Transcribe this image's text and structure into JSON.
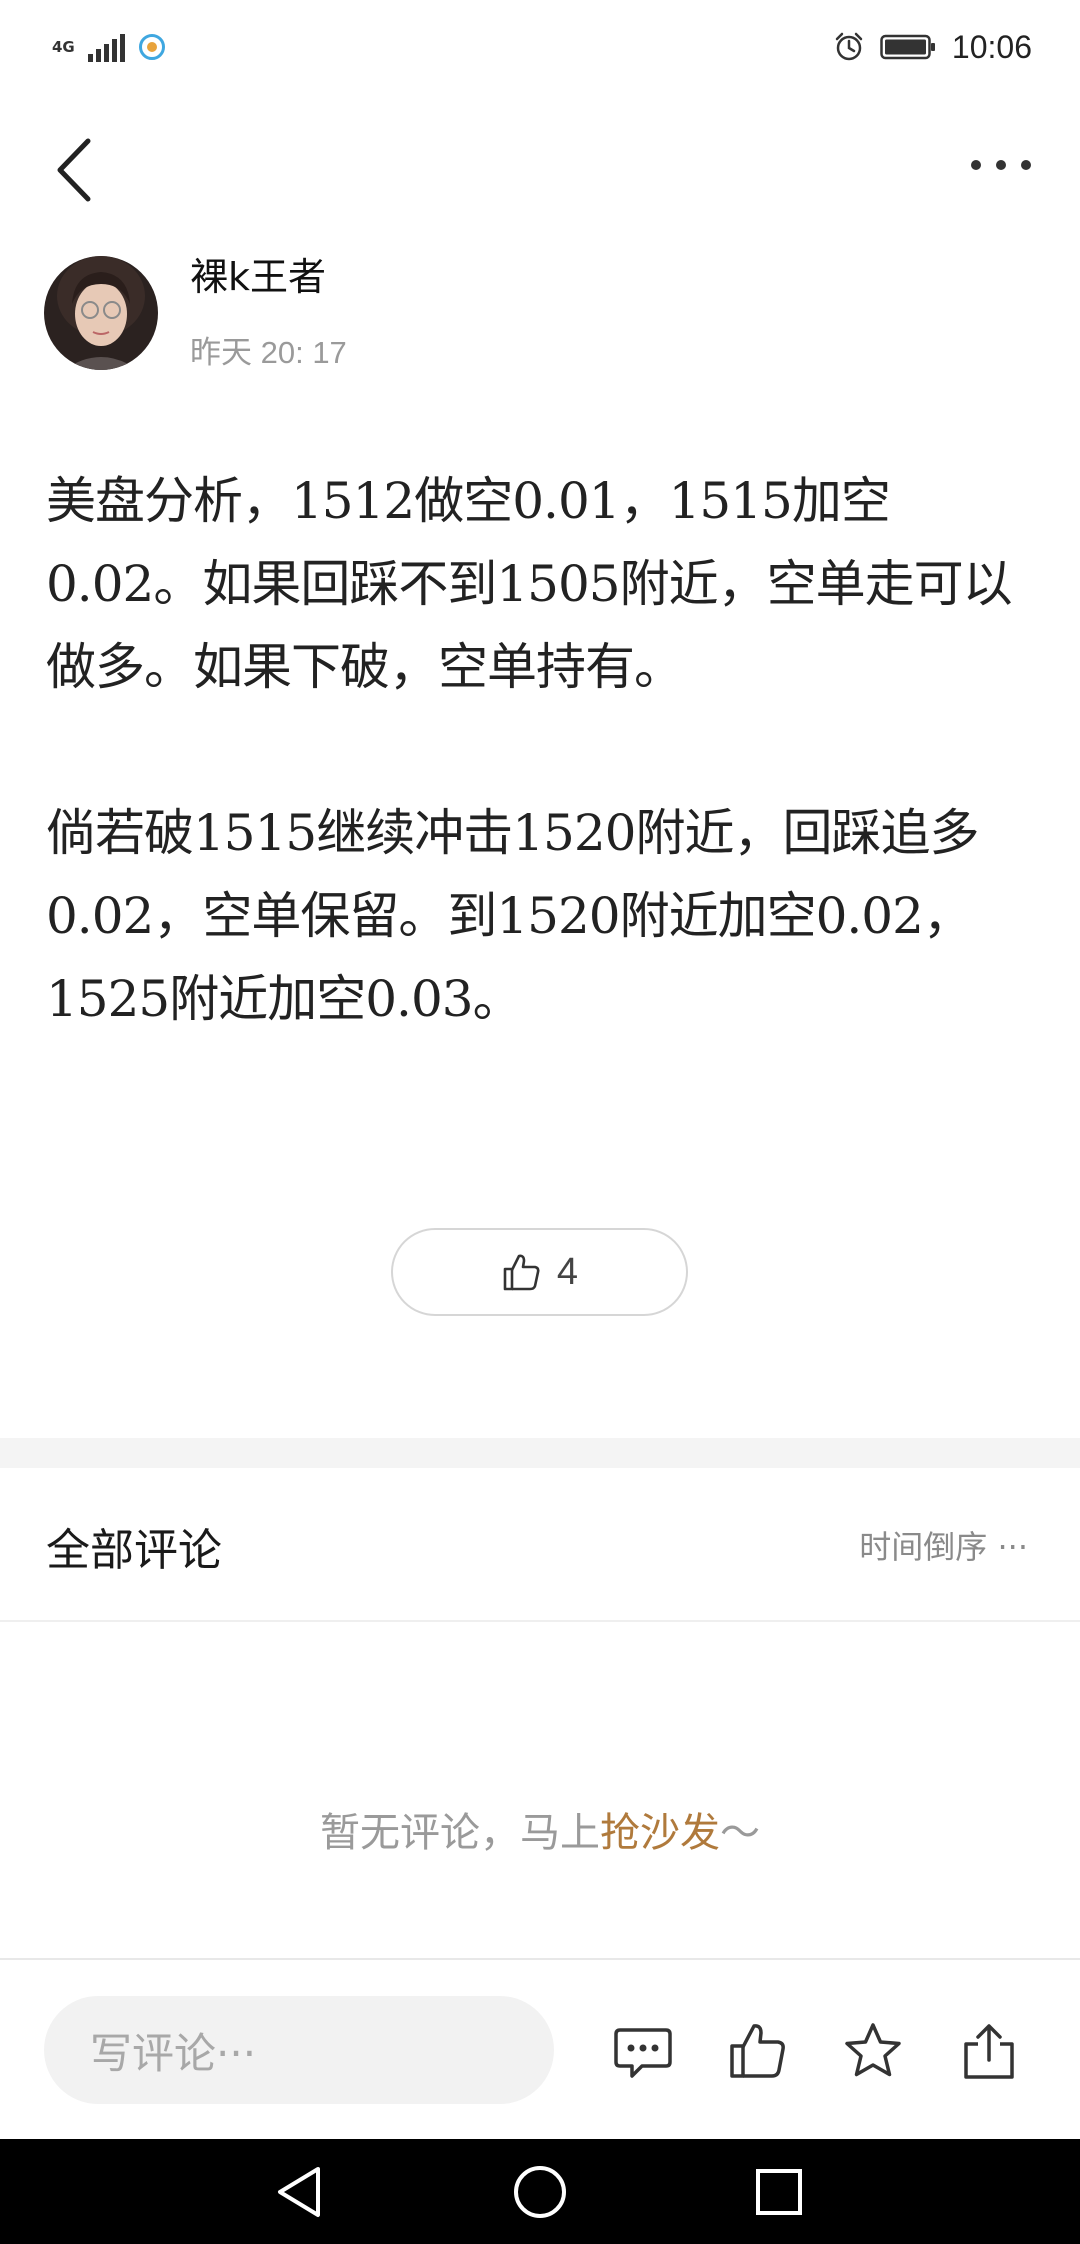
{
  "status_bar": {
    "network_type": "4G",
    "time": "10:06"
  },
  "colors": {
    "accent": "#b07a3c",
    "muted_text": "#9a9a9a",
    "divider": "#f4f4f4"
  },
  "author": {
    "name": "裸k王者",
    "time": "昨天 20: 17"
  },
  "post": {
    "paragraphs": [
      "美盘分析，1512做空0.01，1515加空0.02。如果回踩不到1505附近，空单走可以做多。如果下破，空单持有。",
      "倘若破1515继续冲击1520附近，回踩追多0.02，空单保留。到1520附近加空0.02，1525附近加空0.03。"
    ]
  },
  "like": {
    "icon": "thumbs-up-icon",
    "count": "4"
  },
  "comments": {
    "title": "全部评论",
    "sort": "时间倒序 ···",
    "empty_prefix": "暂无评论，马上",
    "empty_link": "抢沙发",
    "empty_suffix": "～"
  },
  "bottom_bar": {
    "input_placeholder": "写评论···",
    "icons": [
      "comment-icon",
      "thumbs-up-icon",
      "star-icon",
      "share-icon"
    ]
  },
  "system_nav": {
    "icons": [
      "back-triangle-icon",
      "home-circle-icon",
      "recents-square-icon"
    ]
  }
}
